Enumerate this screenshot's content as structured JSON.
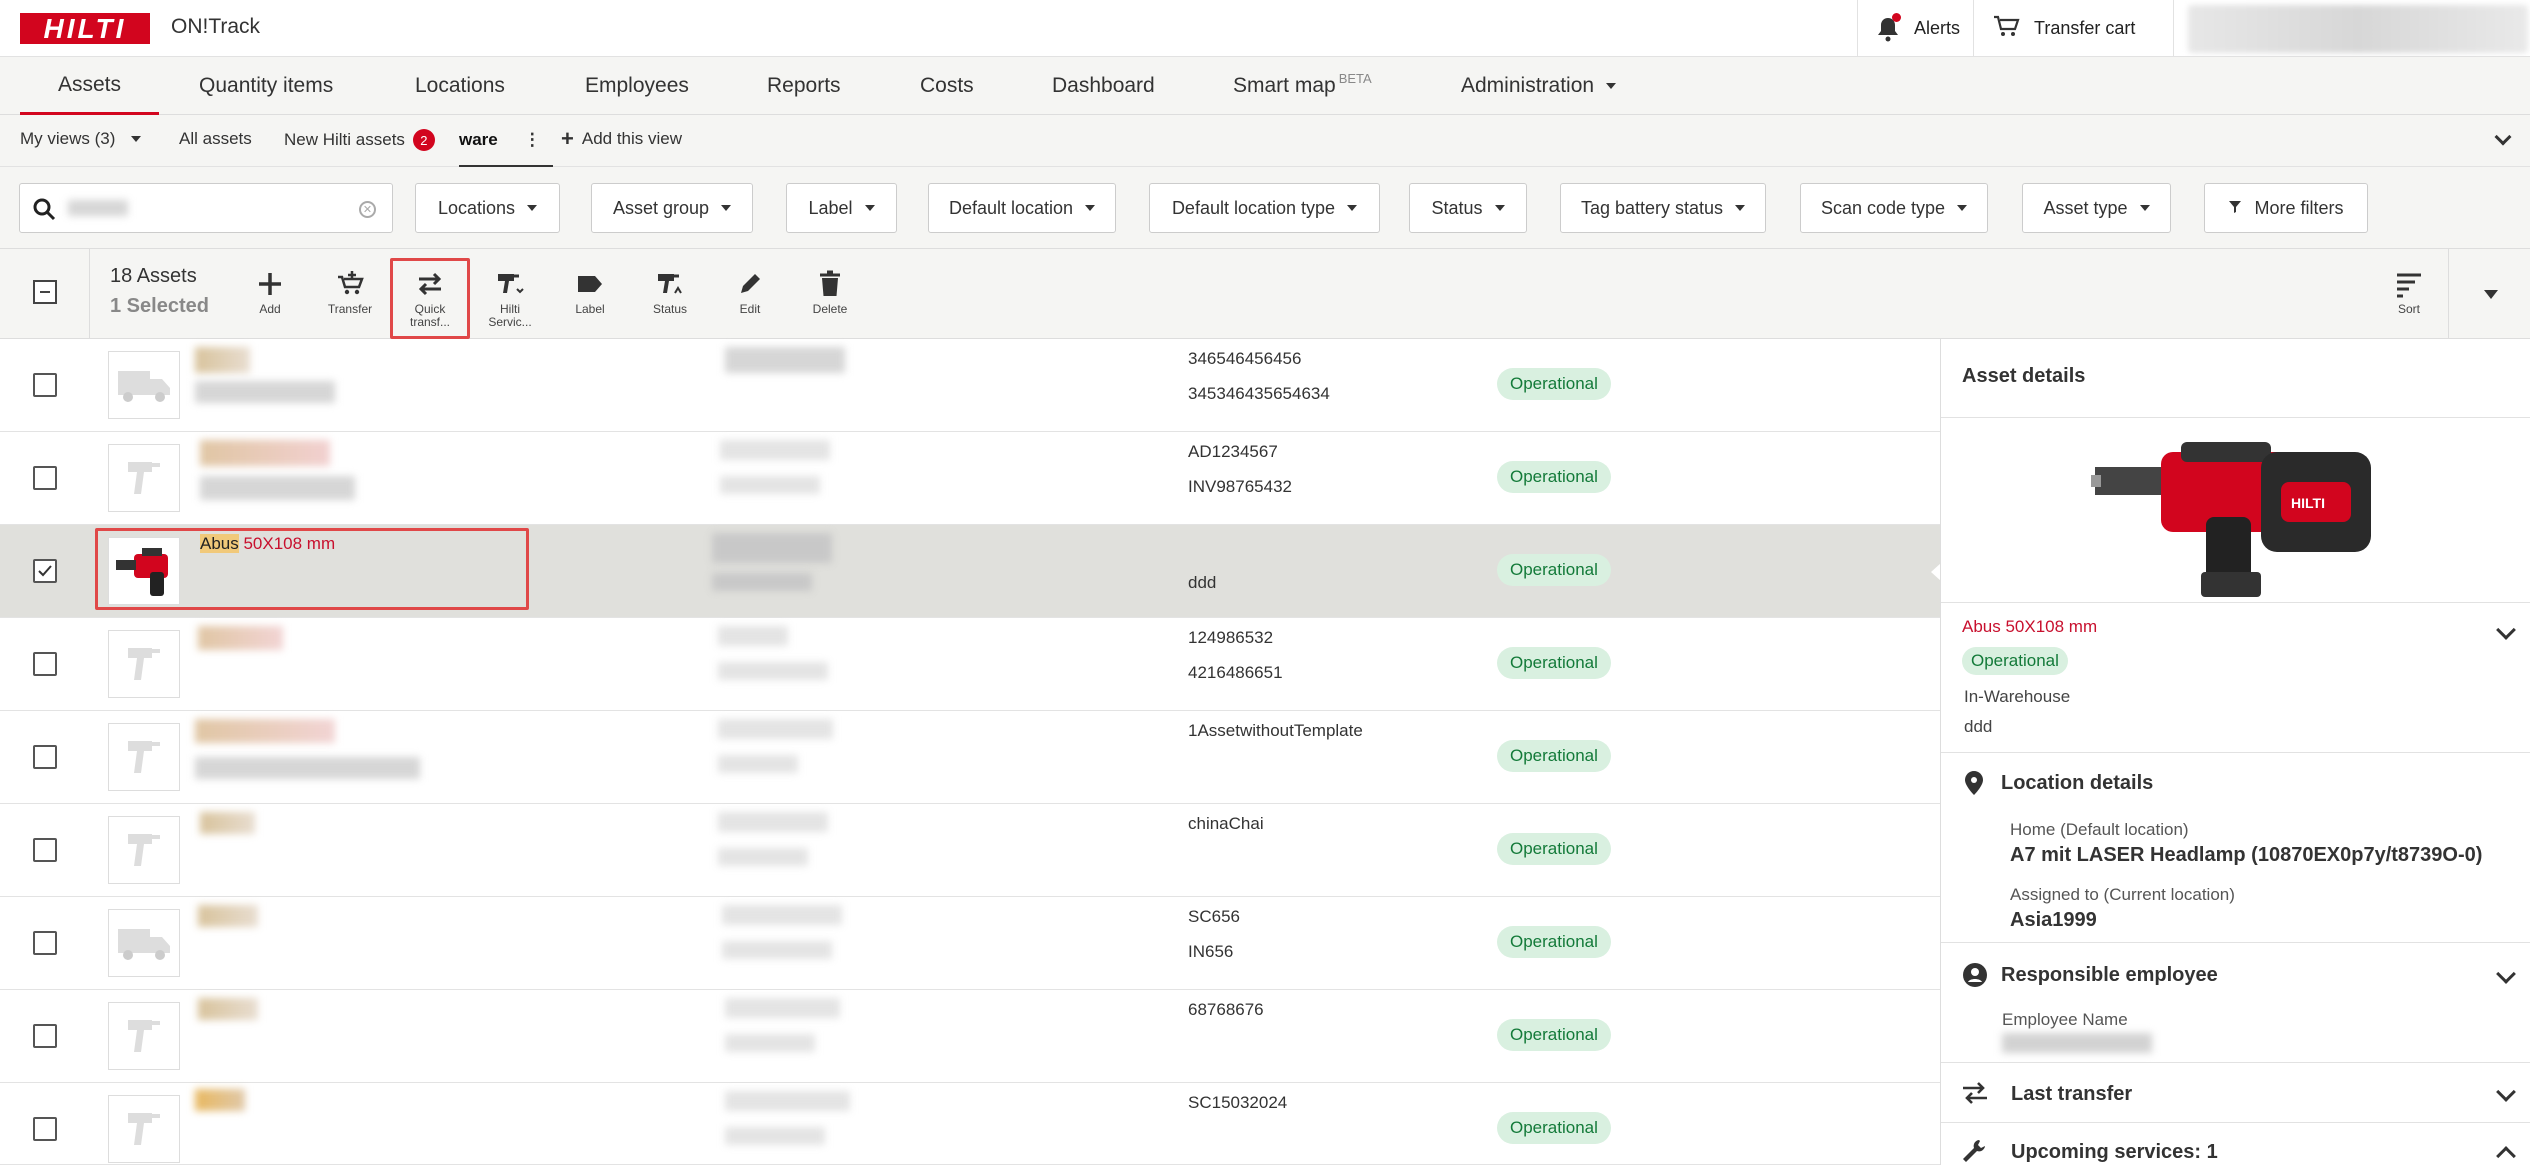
{
  "app": {
    "brand": "HILTI",
    "name": "ON!Track"
  },
  "topbar": {
    "alerts": "Alerts",
    "transfer_cart": "Transfer cart"
  },
  "nav": {
    "tabs": [
      {
        "label": "Assets",
        "active": true
      },
      {
        "label": "Quantity items"
      },
      {
        "label": "Locations"
      },
      {
        "label": "Employees"
      },
      {
        "label": "Reports"
      },
      {
        "label": "Costs"
      },
      {
        "label": "Dashboard"
      },
      {
        "label": "Smart map",
        "badge": "BETA"
      },
      {
        "label": "Administration"
      }
    ]
  },
  "views": {
    "my_views": "My views (3)",
    "all_assets": "All assets",
    "new_hilti": "New Hilti assets",
    "new_hilti_count": "2",
    "current": "ware",
    "add_view": "Add this view"
  },
  "filters": [
    "Locations",
    "Asset group",
    "Label",
    "Default location",
    "Default location type",
    "Status",
    "Tag battery status",
    "Scan code type",
    "Asset type"
  ],
  "more_filters": "More filters",
  "toolbar": {
    "count": "18 Assets",
    "selected": "1 Selected",
    "tools": {
      "add": "Add",
      "transfer": "Transfer",
      "quick1": "Quick",
      "quick2": "transf...",
      "hilti1": "Hilti",
      "hilti2": "Servic...",
      "label": "Label",
      "status": "Status",
      "edit": "Edit",
      "delete": "Delete",
      "sort": "Sort"
    }
  },
  "rows": [
    {
      "id1": "346546456456",
      "id2": "345346435654634",
      "status": "Operational"
    },
    {
      "id1": "AD1234567",
      "id2": "INV98765432",
      "status": "Operational"
    },
    {
      "name_highlight": "Abus",
      "name_rest": " 50X108 mm",
      "id2": "ddd",
      "status": "Operational",
      "selected": true
    },
    {
      "id1": "124986532",
      "id2": "4216486651",
      "status": "Operational"
    },
    {
      "id1": "1AssetwithoutTemplate",
      "status": "Operational"
    },
    {
      "id1": "chinaChai",
      "status": "Operational"
    },
    {
      "id1": "SC656",
      "id2": "IN656",
      "status": "Operational"
    },
    {
      "id1": "68768676",
      "status": "Operational"
    },
    {
      "id1": "SC15032024",
      "status": "Operational"
    }
  ],
  "details": {
    "title": "Asset details",
    "asset_name": "Abus 50X108 mm",
    "status": "Operational",
    "group": "In-Warehouse",
    "identifier": "ddd",
    "location_title": "Location details",
    "home_label": "Home (Default location)",
    "home_value": "A7 mit LASER Headlamp (10870EX0p7y/t8739O-0)",
    "assigned_label": "Assigned to (Current location)",
    "assigned_value": "Asia1999",
    "responsible_title": "Responsible employee",
    "employee_label": "Employee Name",
    "last_transfer": "Last transfer",
    "upcoming": "Upcoming services: 1"
  },
  "colors": {
    "brand": "#d2051e",
    "status_bg": "#d9f0e0",
    "status_fg": "#137a39",
    "highlight": "#e04848"
  }
}
